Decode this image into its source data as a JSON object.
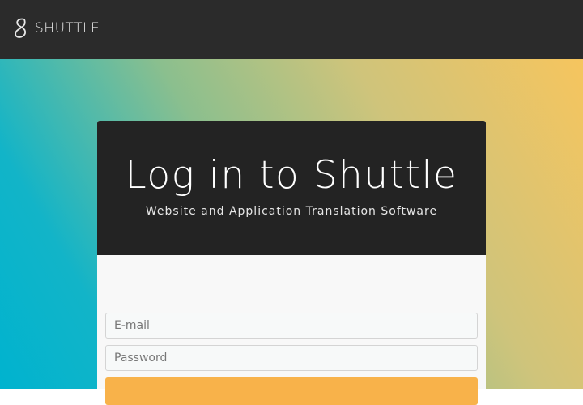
{
  "brand": {
    "name": "SHUTTLE",
    "icon": "shuttle-logo-icon"
  },
  "login": {
    "title": "Log in to Shuttle",
    "subtitle": "Website and Application Translation Software",
    "email_placeholder": "E-mail",
    "password_placeholder": "Password",
    "button_label": ""
  },
  "colors": {
    "topbar": "#2b2b2b",
    "card_header": "#232323",
    "accent_button": "#f8b24a",
    "gradient_start": "#00b3cf",
    "gradient_end": "#f6c55e"
  }
}
